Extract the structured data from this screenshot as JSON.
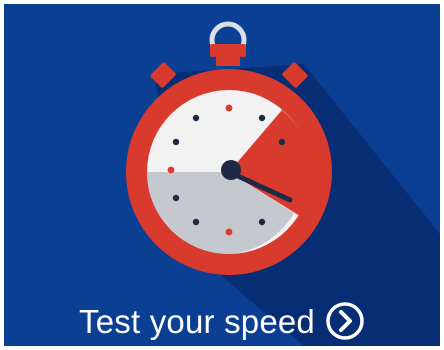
{
  "promo": {
    "cta_label": "Test your speed",
    "cta_icon": "chevron-right-circle-icon",
    "illustration_icon": "stopwatch-icon"
  },
  "colors": {
    "background": "#0B3F94",
    "shadow": "#072B6E",
    "stopwatch_red": "#D83A2E",
    "dial_face": "#F2F2F2",
    "dial_grey": "#C5C9CF",
    "hand": "#1E2A44",
    "text": "#FFFFFF"
  }
}
